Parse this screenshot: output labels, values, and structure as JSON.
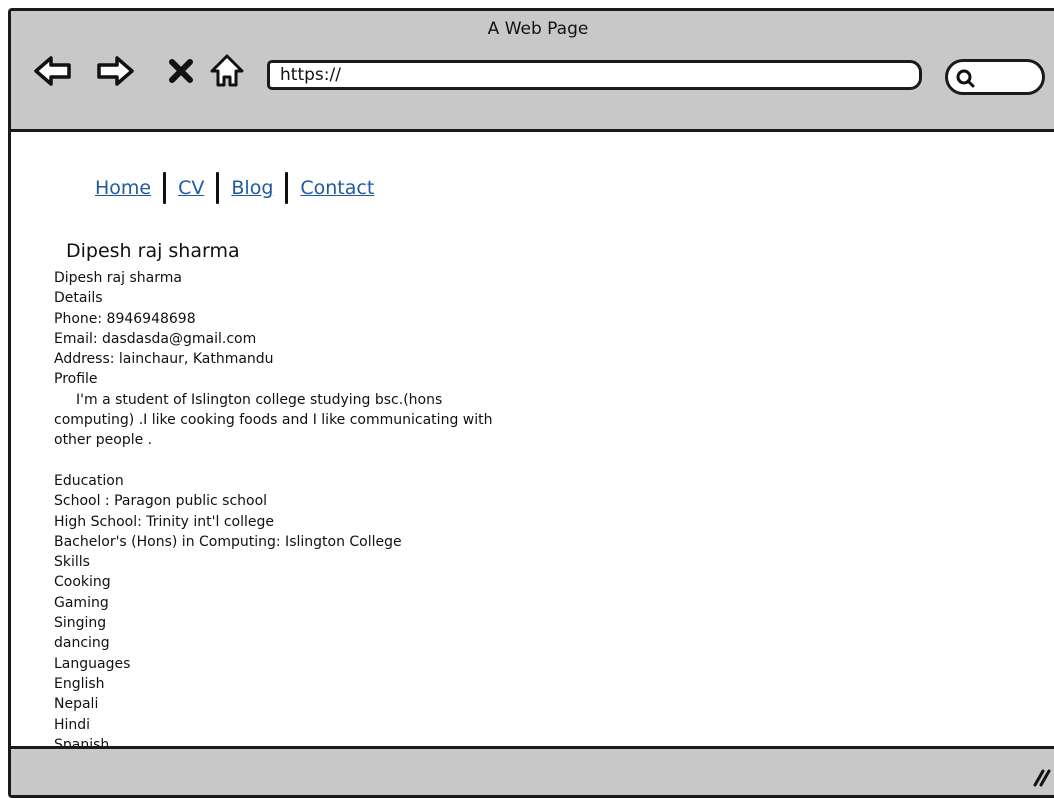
{
  "window": {
    "title": "A Web Page"
  },
  "toolbar": {
    "back_icon": "back-arrow-icon",
    "forward_icon": "forward-arrow-icon",
    "stop_icon": "close-icon",
    "home_icon": "home-icon",
    "address_value": "https://",
    "search_icon": "search-icon"
  },
  "nav": {
    "items": [
      {
        "label": "Home"
      },
      {
        "label": "CV"
      },
      {
        "label": "Blog"
      },
      {
        "label": "Contact"
      }
    ]
  },
  "page": {
    "heading": "Dipesh raj sharma",
    "name": "Dipesh raj sharma",
    "details_label": "Details",
    "phone": "Phone: 8946948698",
    "email": "Email: dasdasda@gmail.com",
    "address": "Address: lainchaur, Kathmandu",
    "profile_label": "Profile",
    "profile_text": "I'm a student of Islington college studying bsc.(hons computing) .I like cooking foods and I like communicating with other people .",
    "education_label": "Education",
    "education": [
      "School : Paragon public school",
      "High School: Trinity int'l college",
      "Bachelor's (Hons) in Computing: Islington College"
    ],
    "skills_label": "Skills",
    "skills": [
      "Cooking",
      "Gaming",
      "Singing",
      "dancing"
    ],
    "languages_label": "Languages",
    "languages": [
      "English",
      "Nepali",
      "Hindi",
      "Spanish"
    ]
  }
}
